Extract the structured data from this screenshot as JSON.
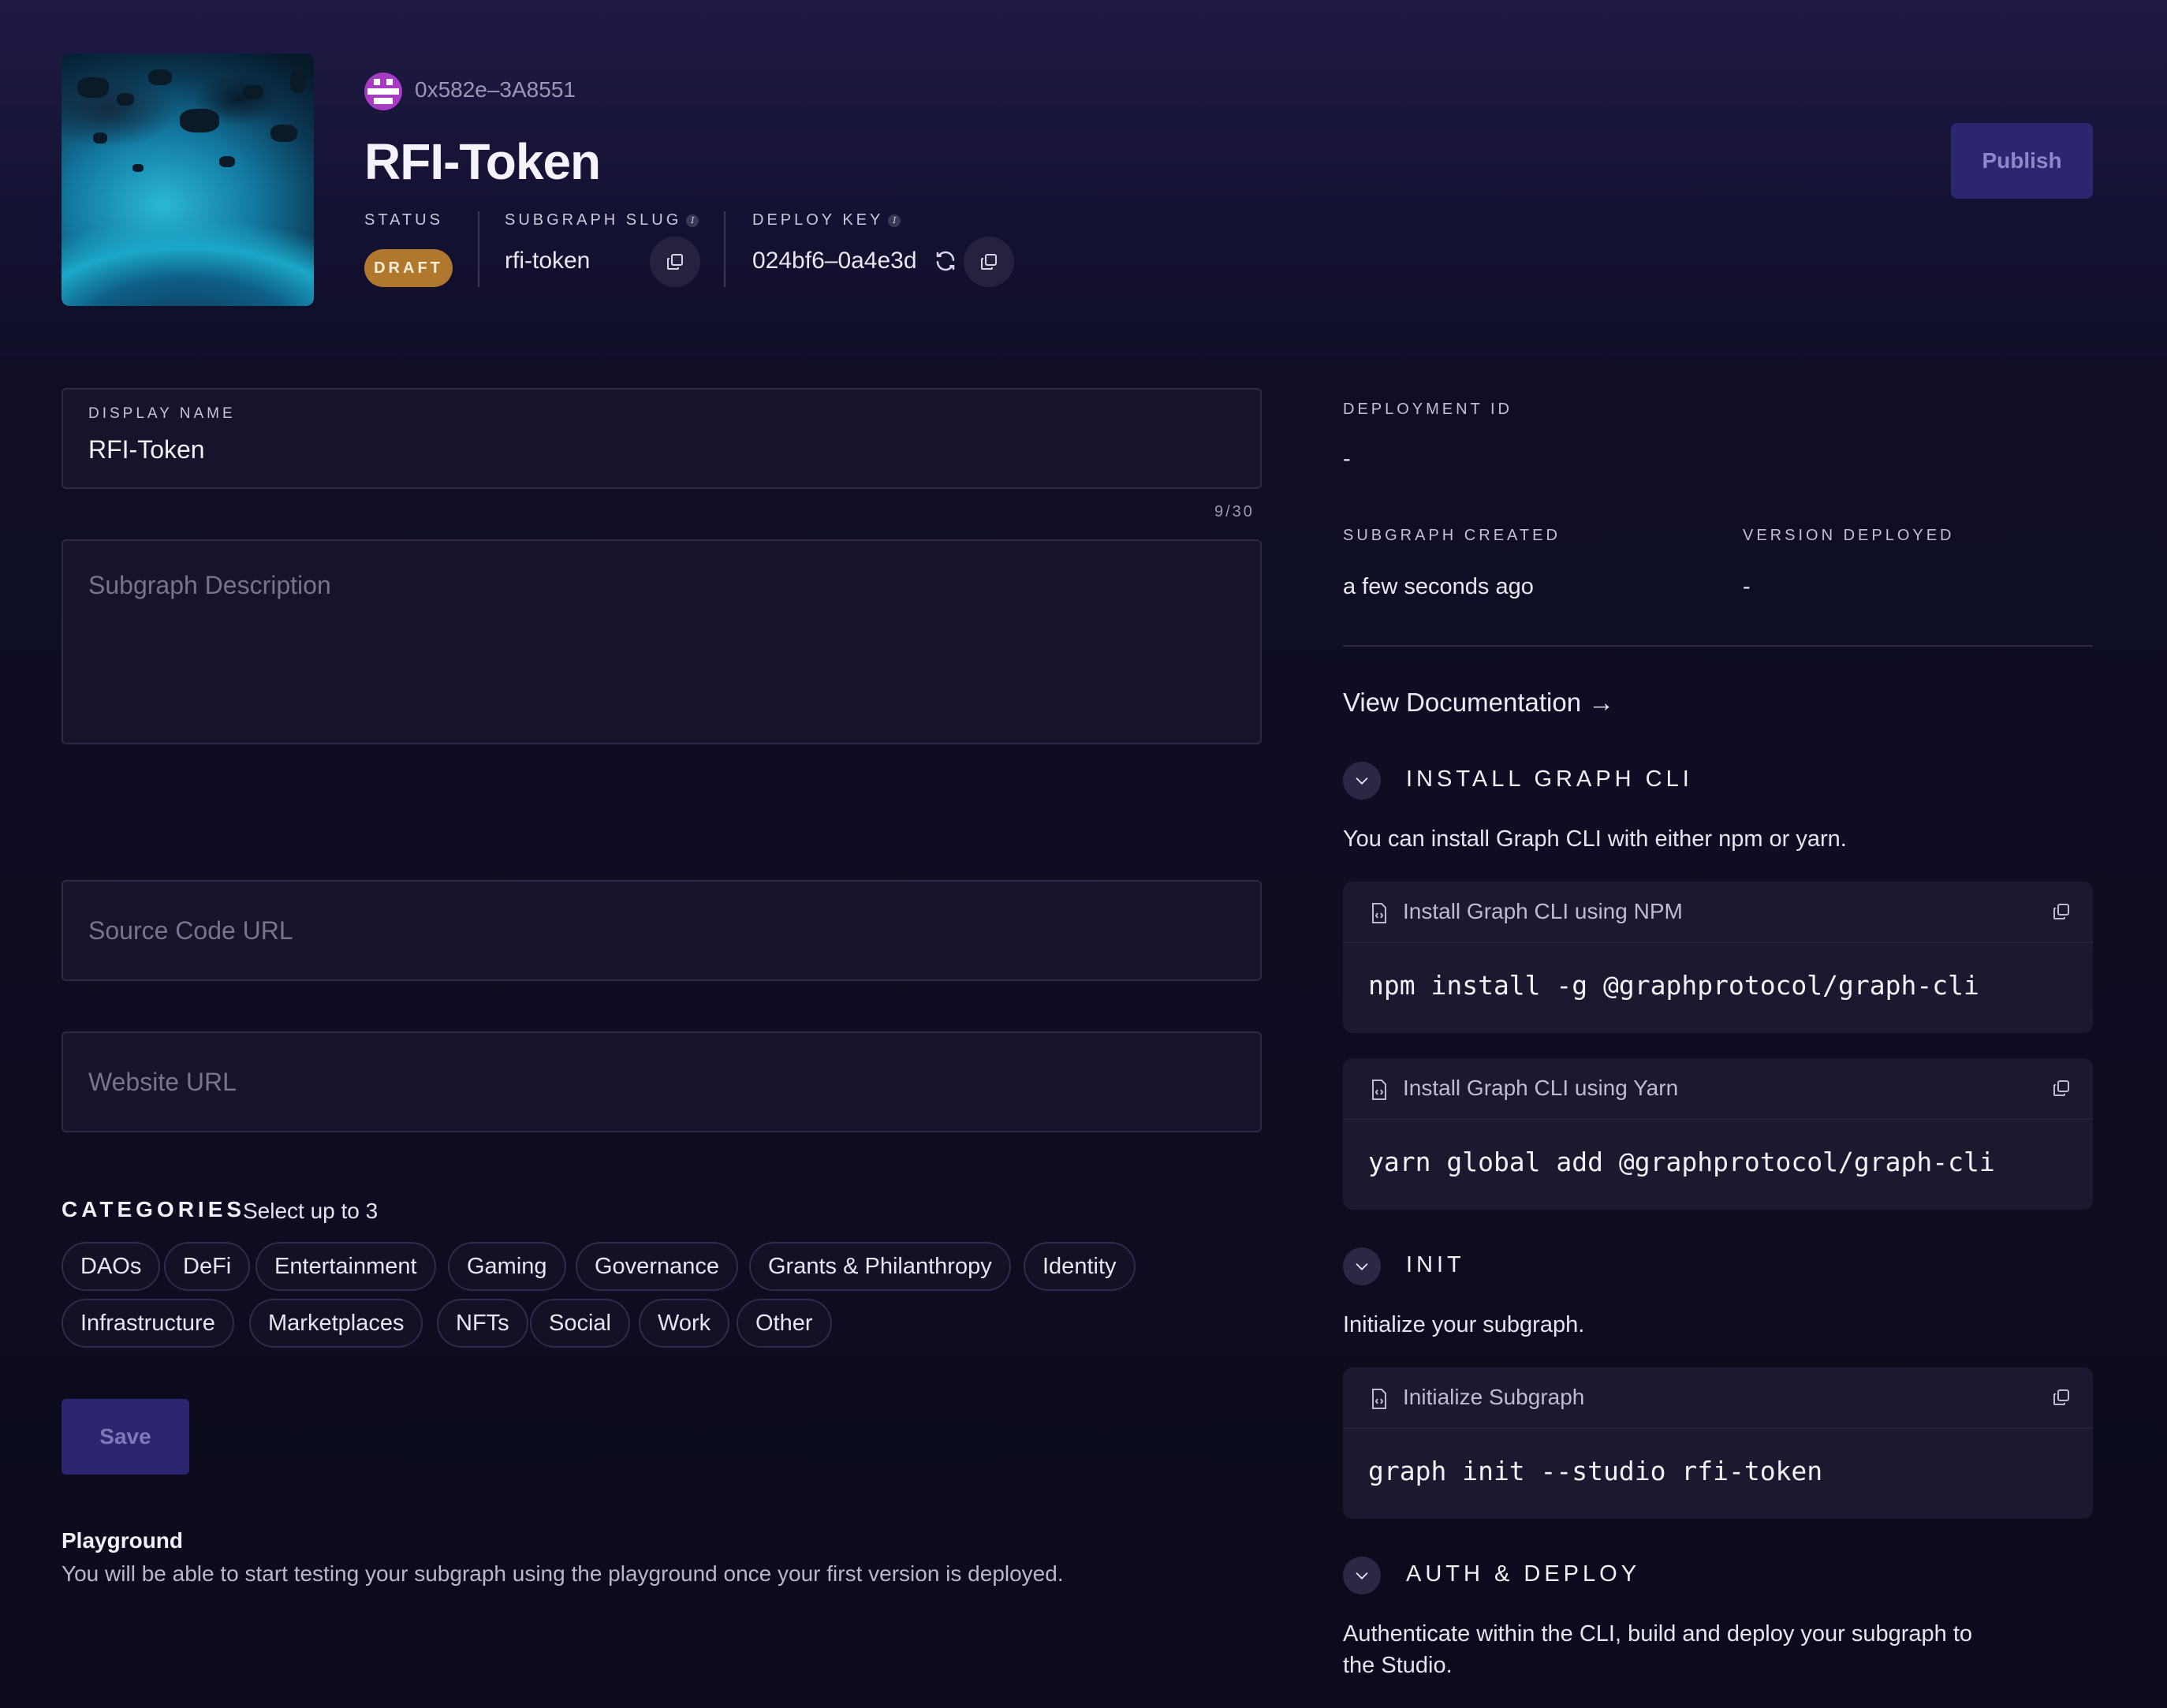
{
  "header": {
    "address": "0x582e–3A8551",
    "title": "RFI-Token",
    "status_label": "STATUS",
    "status_value": "DRAFT",
    "slug_label": "SUBGRAPH SLUG",
    "slug_value": "rfi-token",
    "deploy_key_label": "DEPLOY KEY",
    "deploy_key_value": "024bf6–0a4e3d",
    "publish_label": "Publish"
  },
  "form": {
    "display_name_label": "DISPLAY NAME",
    "display_name_value": "RFI-Token",
    "display_name_counter": "9/30",
    "description_placeholder": "Subgraph Description",
    "source_code_placeholder": "Source Code URL",
    "website_placeholder": "Website URL",
    "categories_title": "CATEGORIES",
    "categories_hint": "Select up to 3",
    "categories": [
      "DAOs",
      "DeFi",
      "Entertainment",
      "Gaming",
      "Governance",
      "Grants & Philanthropy",
      "Identity",
      "Infrastructure",
      "Marketplaces",
      "NFTs",
      "Social",
      "Work",
      "Other"
    ],
    "save_label": "Save",
    "playground_title": "Playground",
    "playground_text": "You will be able to start testing your subgraph using the playground once your first version is deployed."
  },
  "details": {
    "deployment_id_label": "DEPLOYMENT ID",
    "deployment_id_value": "-",
    "created_label": "SUBGRAPH CREATED",
    "created_value": "a few seconds ago",
    "version_label": "VERSION DEPLOYED",
    "version_value": "-",
    "view_docs": "View Documentation →"
  },
  "sections": {
    "install": {
      "title": "INSTALL GRAPH CLI",
      "desc": "You can install Graph CLI with either npm or yarn.",
      "npm_title": "Install Graph CLI using NPM",
      "npm_code": "npm install -g @graphprotocol/graph-cli",
      "yarn_title": "Install Graph CLI using Yarn",
      "yarn_code": "yarn global add @graphprotocol/graph-cli"
    },
    "init": {
      "title": "INIT",
      "desc": "Initialize your subgraph.",
      "card_title": "Initialize Subgraph",
      "code": "graph init --studio rfi-token"
    },
    "auth": {
      "title": "AUTH & DEPLOY",
      "desc_line1": "Authenticate within the CLI, build and deploy your subgraph to",
      "desc_line2": "the Studio."
    }
  },
  "colors": {
    "background": "#0c0b1d",
    "accent_button": "#2c2670",
    "draft_badge": "#b0782c"
  },
  "icons": [
    "avatar-icon",
    "info-icon",
    "copy-icon",
    "refresh-icon",
    "chevron-down-icon",
    "file-code-icon",
    "arrow-right-icon"
  ]
}
